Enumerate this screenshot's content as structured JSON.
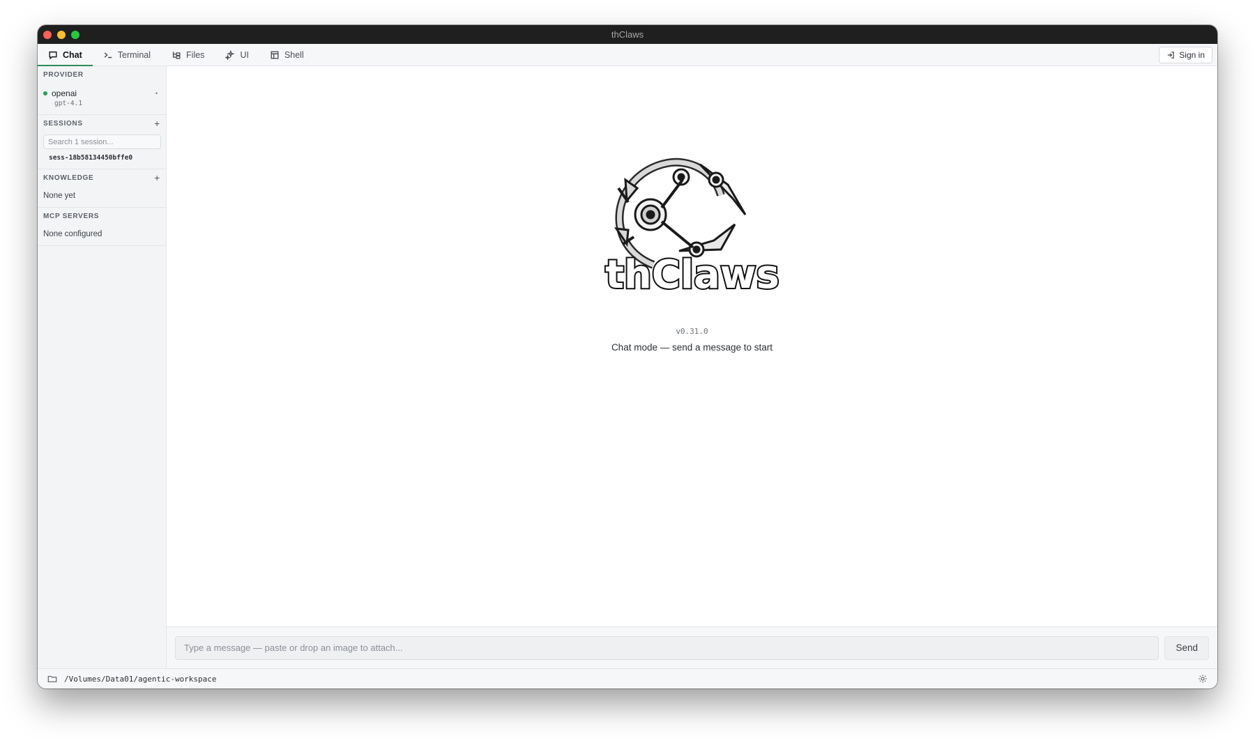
{
  "window": {
    "title": "thClaws"
  },
  "tabs": [
    {
      "label": "Chat",
      "icon": "chat-bubble-icon",
      "active": true
    },
    {
      "label": "Terminal",
      "icon": "terminal-icon"
    },
    {
      "label": "Files",
      "icon": "file-tree-icon"
    },
    {
      "label": "UI",
      "icon": "sparkle-icon"
    },
    {
      "label": "Shell",
      "icon": "window-icon"
    }
  ],
  "header": {
    "sign_in_label": "Sign in"
  },
  "sidebar": {
    "provider": {
      "heading": "PROVIDER",
      "name": "openai",
      "model": "gpt-4.1",
      "status_color": "#22a35a"
    },
    "sessions": {
      "heading": "SESSIONS",
      "add_label": "+",
      "search_placeholder": "Search 1 session...",
      "items": [
        "sess-18b58134450bffe0"
      ]
    },
    "knowledge": {
      "heading": "KNOWLEDGE",
      "add_label": "+",
      "empty_text": "None yet"
    },
    "mcp": {
      "heading": "MCP SERVERS",
      "empty_text": "None configured"
    }
  },
  "hero": {
    "brand": "thClaws",
    "version": "v0.31.0",
    "hint": "Chat mode — send a message to start"
  },
  "composer": {
    "placeholder": "Type a message — paste or drop an image to attach...",
    "send_label": "Send"
  },
  "status": {
    "workspace_path": "/Volumes/Data01/agentic-workspace"
  },
  "colors": {
    "accent": "#2e8b57",
    "titlebar": "#1f1f1f"
  }
}
